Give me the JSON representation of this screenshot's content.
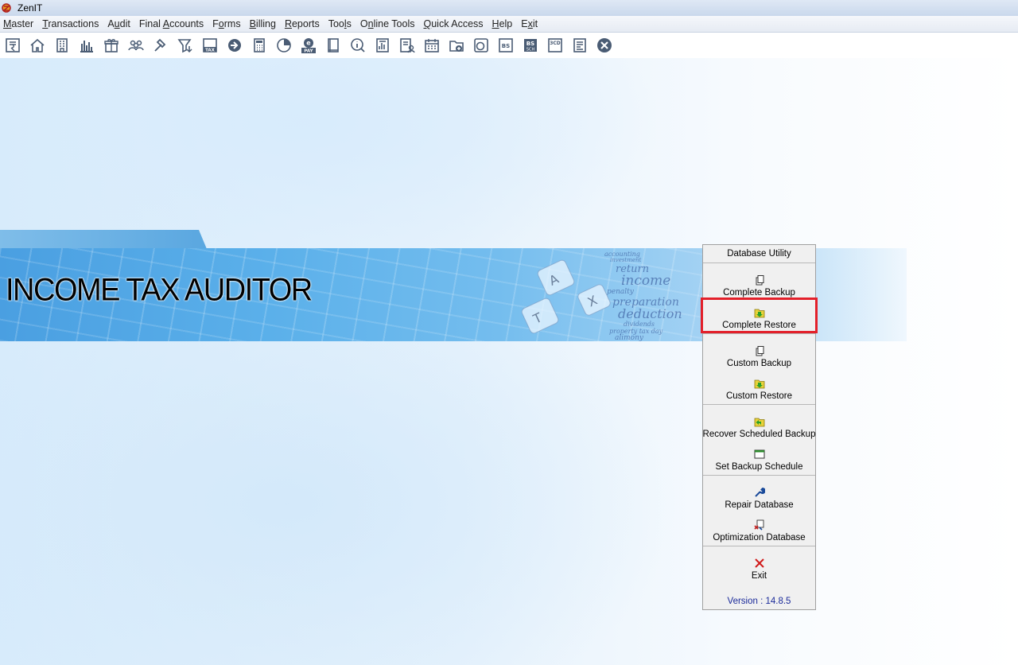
{
  "window": {
    "title": "ZenIT"
  },
  "menu": [
    {
      "pre": "",
      "ul": "M",
      "post": "aster"
    },
    {
      "pre": "",
      "ul": "T",
      "post": "ransactions"
    },
    {
      "pre": "A",
      "ul": "u",
      "post": "dit"
    },
    {
      "pre": "Final ",
      "ul": "A",
      "post": "ccounts"
    },
    {
      "pre": "F",
      "ul": "o",
      "post": "rms"
    },
    {
      "pre": "",
      "ul": "B",
      "post": "illing"
    },
    {
      "pre": "",
      "ul": "R",
      "post": "eports"
    },
    {
      "pre": "Too",
      "ul": "l",
      "post": "s"
    },
    {
      "pre": "O",
      "ul": "n",
      "post": "line Tools"
    },
    {
      "pre": "",
      "ul": "Q",
      "post": "uick Access"
    },
    {
      "pre": "",
      "ul": "H",
      "post": "elp"
    },
    {
      "pre": "E",
      "ul": "x",
      "post": "it"
    }
  ],
  "toolbar": {
    "icons": [
      "rupee-voucher-icon",
      "home-icon",
      "building-icon",
      "bar-chart-icon",
      "gift-icon",
      "users-group-icon",
      "hammer-icon",
      "filter-icon",
      "tax-icon",
      "flow-icon",
      "calculator-icon",
      "pie-chart-icon",
      "epay-icon",
      "book-icon",
      "info-search-icon",
      "report-icon",
      "user-report-icon",
      "calendar-icon",
      "folder-add-icon",
      "chat-icon",
      "bs-icon",
      "bs-sch-icon",
      "3cd-icon",
      "ledger-icon",
      "close-circle-icon"
    ],
    "tax_text": "TAX",
    "pay_text": "PAY",
    "bs_text": "BS",
    "sch_text": "SCH",
    "cd3_text": "3CD"
  },
  "banner": {
    "title": "INCOME TAX AUDITOR",
    "words": [
      "accounting",
      "investment",
      "return",
      "income",
      "penalty",
      "preparation",
      "deduction",
      "dividends",
      "property tax day",
      "alimony"
    ]
  },
  "db_utility": {
    "header": "Database Utility",
    "groups": [
      [
        {
          "label": "Complete Backup",
          "icon": "copy-icon"
        },
        {
          "label": "Complete Restore",
          "icon": "restore-folder-icon",
          "highlight": true
        }
      ],
      [
        {
          "label": "Custom Backup",
          "icon": "copy-icon"
        },
        {
          "label": "Custom Restore",
          "icon": "restore-folder-icon"
        }
      ],
      [
        {
          "label": "Recover Scheduled Backup",
          "icon": "recover-folder-icon"
        },
        {
          "label": "Set Backup Schedule",
          "icon": "window-icon"
        }
      ],
      [
        {
          "label": "Repair Database",
          "icon": "wrench-icon"
        },
        {
          "label": "Optimization Database",
          "icon": "optimize-icon"
        }
      ],
      [
        {
          "label": "Exit",
          "icon": "exit-x-icon"
        }
      ]
    ],
    "version": "Version : 14.8.5"
  },
  "colors": {
    "highlight": "#e3202a",
    "version_text": "#1a2a9a",
    "banner_blue": "#4a9fe1"
  }
}
